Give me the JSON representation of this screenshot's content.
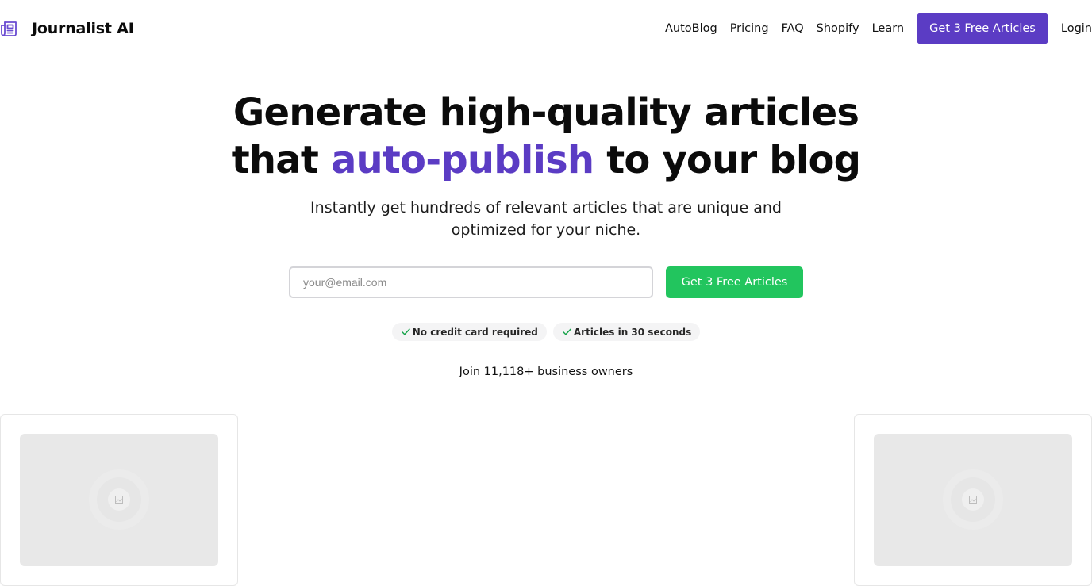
{
  "header": {
    "brand_name": "Journalist AI",
    "nav": [
      "AutoBlog",
      "Pricing",
      "FAQ",
      "Shopify",
      "Learn"
    ],
    "cta_label": "Get 3 Free Articles",
    "login_label": "Login"
  },
  "hero": {
    "title_line1": "Generate high-quality articles",
    "title_line2_before": "that ",
    "title_line2_accent": "auto-publish",
    "title_line2_after": " to your blog",
    "subtitle": "Instantly get hundreds of relevant articles that are unique and optimized for your niche."
  },
  "signup": {
    "email_placeholder": "your@email.com",
    "email_value": "",
    "button_label": "Get 3 Free Articles"
  },
  "badges": [
    "No credit card required",
    "Articles in 30 seconds"
  ],
  "social_proof": "Join 11,118+ business owners",
  "colors": {
    "brand_purple": "#5b3cc4",
    "cta_green": "#22c55e",
    "badge_bg": "#f4f4f5",
    "placeholder_gray": "#e8e8e8"
  },
  "icons": {
    "brand": "newspaper-icon",
    "badge": "check-icon",
    "card_image": "image-placeholder-icon"
  }
}
